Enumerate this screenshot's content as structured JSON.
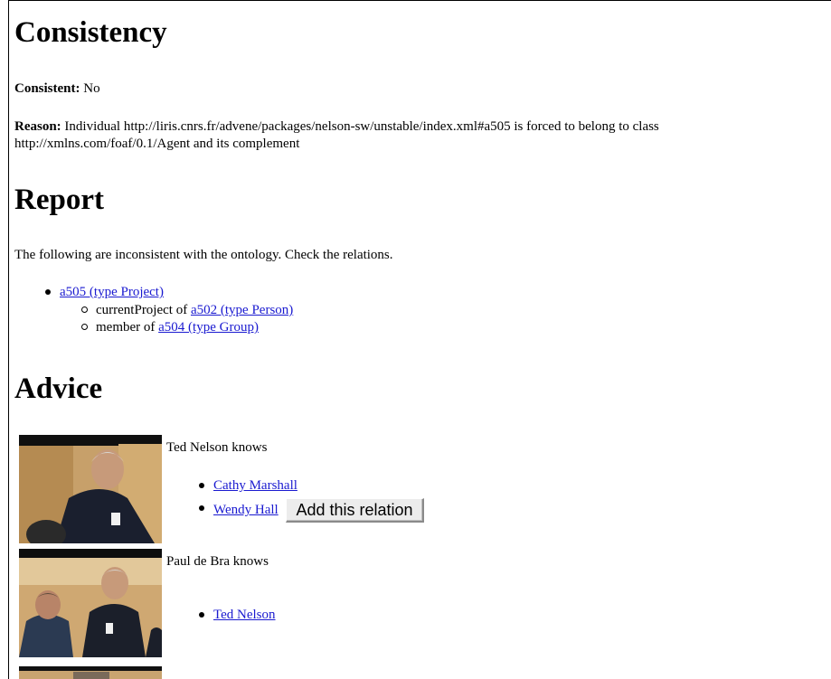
{
  "consistency": {
    "heading": "Consistency",
    "consistent_label": "Consistent:",
    "consistent_value": "No",
    "reason_label": "Reason:",
    "reason_text": "Individual http://liris.cnrs.fr/advene/packages/nelson-sw/unstable/index.xml#a505 is forced to belong to class http://xmlns.com/foaf/0.1/Agent and its complement"
  },
  "report": {
    "heading": "Report",
    "intro": "The following are inconsistent with the ontology. Check the relations.",
    "items": [
      {
        "link": "a505 (type Project)",
        "sub": [
          {
            "prefix": "currentProject of ",
            "link": "a502 (type Person)"
          },
          {
            "prefix": "member of ",
            "link": "a504 (type Group)"
          }
        ]
      }
    ]
  },
  "advice": {
    "heading": "Advice",
    "blocks": [
      {
        "text": "Ted Nelson knows",
        "links": [
          "Cathy Marshall",
          "Wendy Hall"
        ],
        "button_label": "Add this relation"
      },
      {
        "text": "Paul de Bra knows",
        "links": [
          "Ted Nelson"
        ]
      }
    ]
  },
  "colors": {
    "link": "#1a1ad0",
    "button_bg": "#ececec"
  }
}
